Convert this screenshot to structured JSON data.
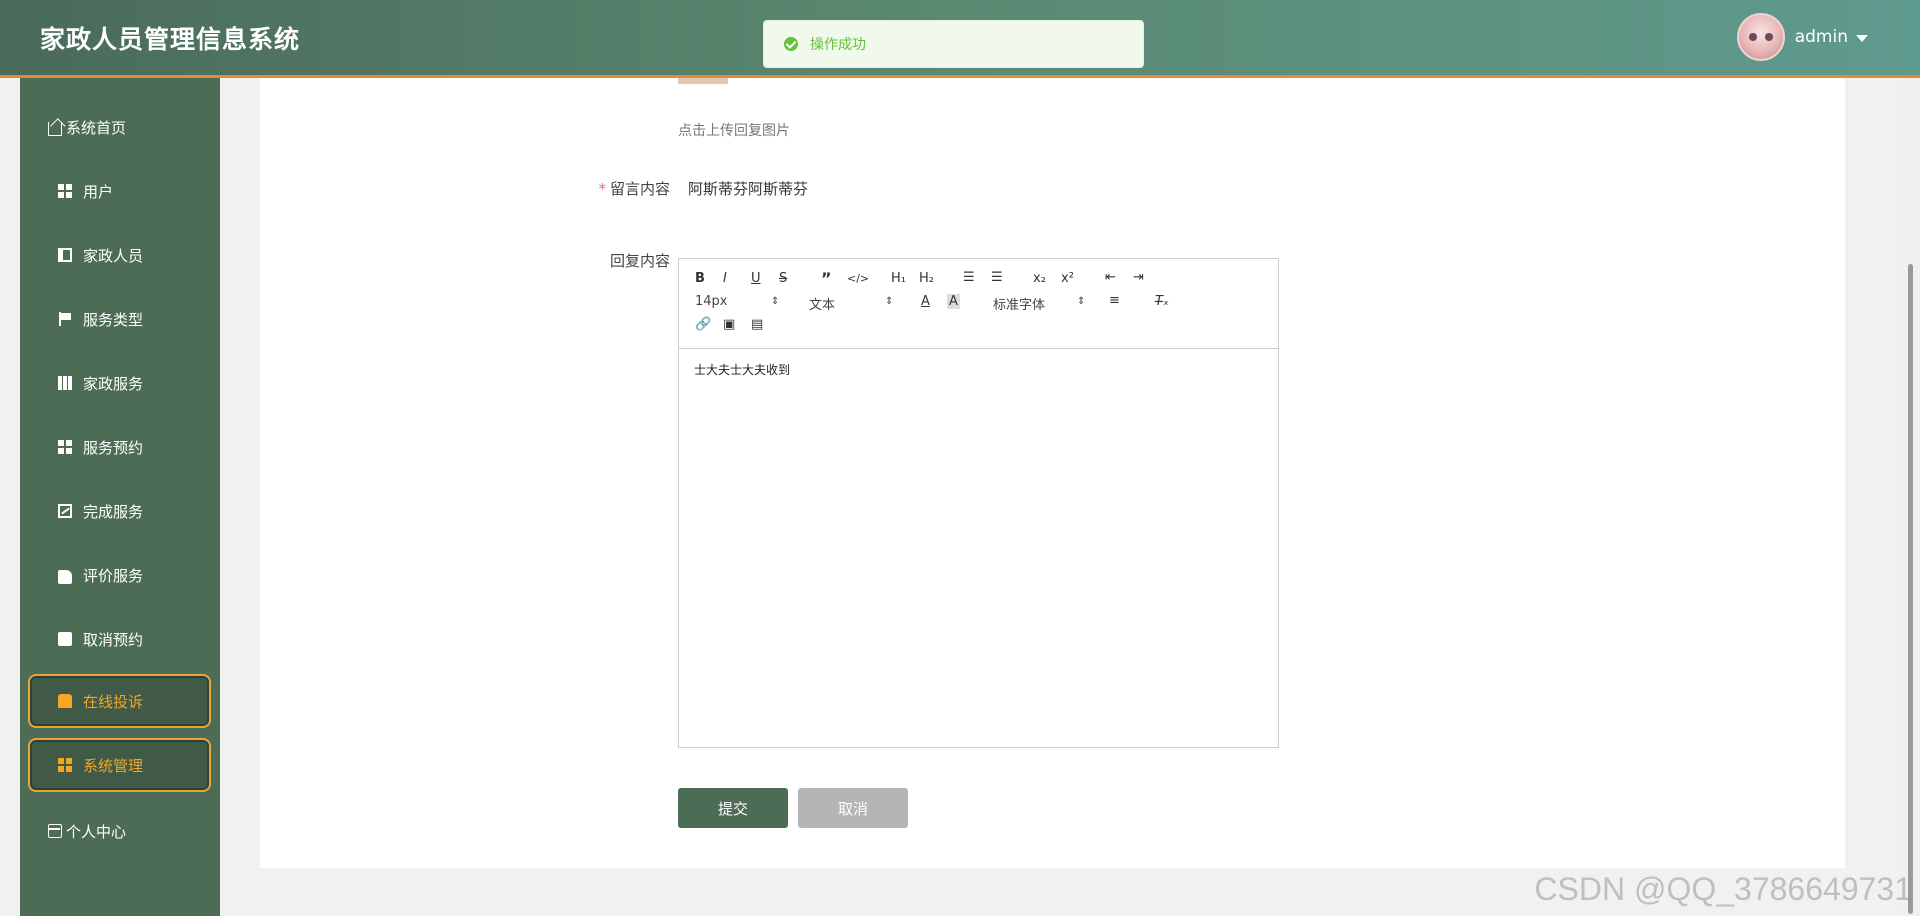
{
  "header": {
    "title": "家政人员管理信息系统",
    "username": "admin",
    "avatar_icon": "anime-avatar",
    "accent_color": "#e8893a"
  },
  "toast": {
    "message": "操作成功",
    "icon": "success-check-icon",
    "color": "#67c23a"
  },
  "sidebar": {
    "items": [
      {
        "label": "系统首页",
        "icon": "home-icon"
      },
      {
        "label": "用户",
        "icon": "grid-icon"
      },
      {
        "label": "家政人员",
        "icon": "book-icon"
      },
      {
        "label": "服务类型",
        "icon": "flag-icon"
      },
      {
        "label": "家政服务",
        "icon": "table-icon"
      },
      {
        "label": "服务预约",
        "icon": "grid-icon"
      },
      {
        "label": "完成服务",
        "icon": "chart-icon"
      },
      {
        "label": "评价服务",
        "icon": "hand-icon"
      },
      {
        "label": "取消预约",
        "icon": "clipboard-icon"
      },
      {
        "label": "在线投诉",
        "icon": "chat-icon",
        "active": true
      },
      {
        "label": "系统管理",
        "icon": "grid-icon",
        "active": true
      },
      {
        "label": "个人中心",
        "icon": "card-icon"
      }
    ],
    "active_color": "#f5a623",
    "background": "#4d6c56"
  },
  "form": {
    "upload_hint": "点击上传回复图片",
    "message_label": "留言内容",
    "message_value": "阿斯蒂芬阿斯蒂芬",
    "reply_label": "回复内容",
    "editor": {
      "font_size": "14px",
      "block_format": "文本",
      "font_family": "标准字体",
      "content": "士大夫士大夫收到"
    },
    "submit_label": "提交",
    "cancel_label": "取消"
  },
  "watermark": "CSDN @QQ_3786649731"
}
